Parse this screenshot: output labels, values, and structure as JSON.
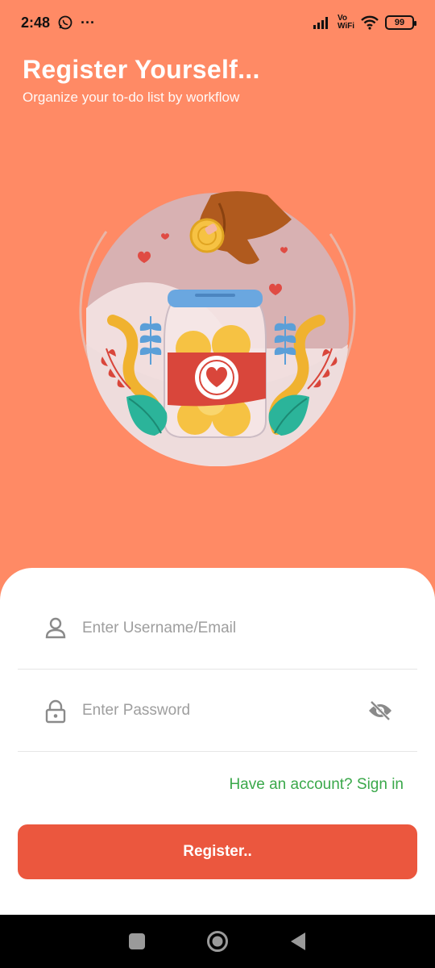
{
  "status_bar": {
    "time": "2:48",
    "dots": "···",
    "vo": "Vo",
    "wifi_label": "WiFi",
    "battery": "99"
  },
  "header": {
    "title": "Register Yourself...",
    "subtitle": "Organize your to-do list by workflow"
  },
  "form": {
    "username_placeholder": "Enter Username/Email",
    "username_value": "",
    "password_placeholder": "Enter Password",
    "password_value": "",
    "signin_link": "Have an account? Sign in",
    "register_label": "Register.."
  },
  "colors": {
    "background": "#FF8A65",
    "primary_button": "#EB573E",
    "link": "#3aa84a"
  }
}
